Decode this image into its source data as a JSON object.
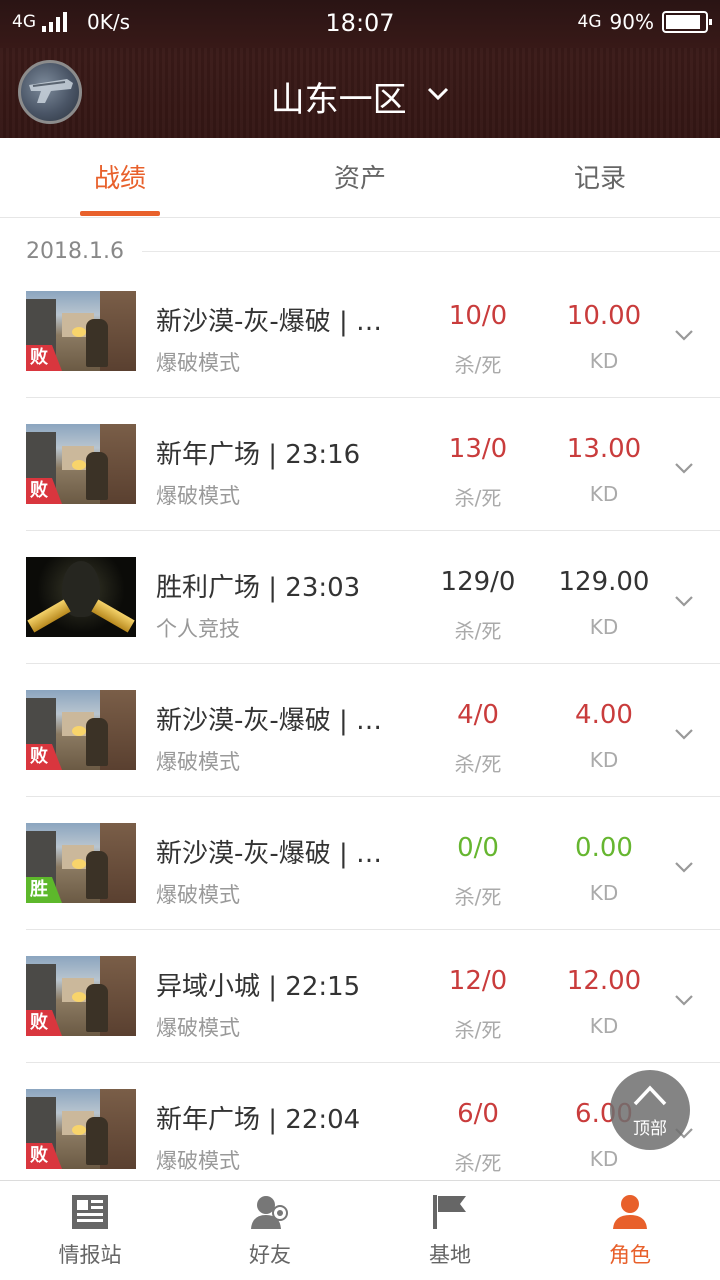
{
  "status_bar": {
    "network": "4G",
    "speed": "0K/s",
    "time": "18:07",
    "network_right": "4G",
    "battery": "90%",
    "battery_level": 0.9
  },
  "header": {
    "region": "山东一区"
  },
  "tabs": [
    {
      "label": "战绩",
      "active": true
    },
    {
      "label": "资产",
      "active": false
    },
    {
      "label": "记录",
      "active": false
    }
  ],
  "date": "2018.1.6",
  "stat_labels": {
    "kd": "杀/死",
    "kdr": "KD"
  },
  "matches": [
    {
      "map": "新沙漠-灰-爆破 | …",
      "mode": "爆破模式",
      "kd": "10/0",
      "kdr": "10.00",
      "result": "败",
      "thumb": "desert",
      "color": "red"
    },
    {
      "map": "新年广场 | 23:16",
      "mode": "爆破模式",
      "kd": "13/0",
      "kdr": "13.00",
      "result": "败",
      "thumb": "desert",
      "color": "red"
    },
    {
      "map": "胜利广场 | 23:03",
      "mode": "个人竞技",
      "kd": "129/0",
      "kdr": "129.00",
      "result": "",
      "thumb": "gold",
      "color": "dark"
    },
    {
      "map": "新沙漠-灰-爆破 | …",
      "mode": "爆破模式",
      "kd": "4/0",
      "kdr": "4.00",
      "result": "败",
      "thumb": "desert",
      "color": "red"
    },
    {
      "map": "新沙漠-灰-爆破 | …",
      "mode": "爆破模式",
      "kd": "0/0",
      "kdr": "0.00",
      "result": "胜",
      "thumb": "desert",
      "color": "green"
    },
    {
      "map": "异域小城 | 22:15",
      "mode": "爆破模式",
      "kd": "12/0",
      "kdr": "12.00",
      "result": "败",
      "thumb": "desert",
      "color": "red"
    },
    {
      "map": "新年广场 | 22:04",
      "mode": "爆破模式",
      "kd": "6/0",
      "kdr": "6.00",
      "result": "败",
      "thumb": "desert",
      "color": "red"
    }
  ],
  "top_button": {
    "label": "顶部"
  },
  "bottom_nav": [
    {
      "label": "情报站",
      "icon": "news-icon",
      "active": false
    },
    {
      "label": "好友",
      "icon": "friends-icon",
      "active": false
    },
    {
      "label": "基地",
      "icon": "flag-icon",
      "active": false
    },
    {
      "label": "角色",
      "icon": "person-icon",
      "active": true
    }
  ],
  "colors": {
    "accent": "#e8602b",
    "loss": "#d9363e",
    "win": "#5db82b",
    "stat_red": "#c93c3c",
    "stat_green": "#66b630"
  }
}
